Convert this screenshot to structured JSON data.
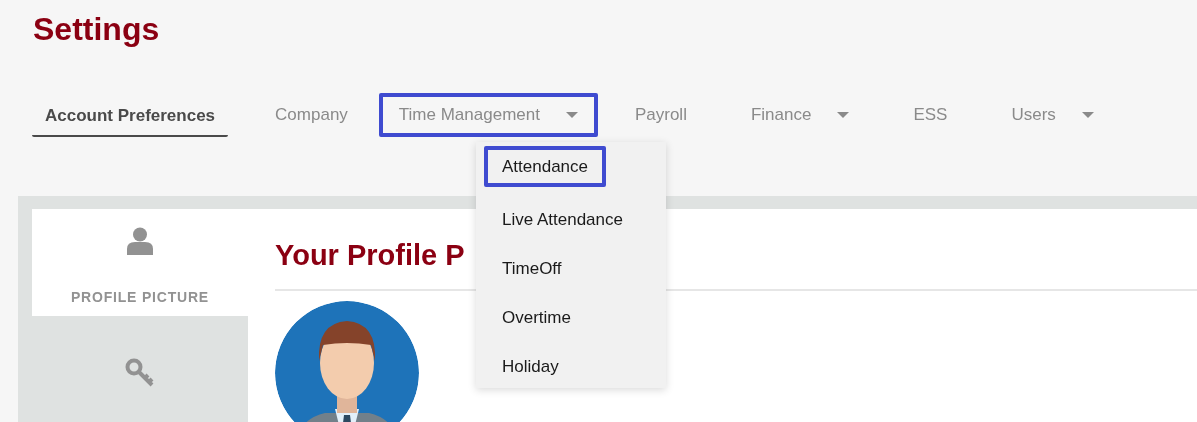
{
  "page_title": "Settings",
  "tabs": [
    {
      "label": "Account Preferences",
      "selected": true,
      "has_dropdown": false,
      "highlighted": false
    },
    {
      "label": "Company",
      "selected": false,
      "has_dropdown": false,
      "highlighted": false
    },
    {
      "label": "Time Management",
      "selected": false,
      "has_dropdown": true,
      "highlighted": true
    },
    {
      "label": "Payroll",
      "selected": false,
      "has_dropdown": false,
      "highlighted": false
    },
    {
      "label": "Finance",
      "selected": false,
      "has_dropdown": true,
      "highlighted": false
    },
    {
      "label": "ESS",
      "selected": false,
      "has_dropdown": false,
      "highlighted": false
    },
    {
      "label": "Users",
      "selected": false,
      "has_dropdown": true,
      "highlighted": false
    }
  ],
  "dropdown": {
    "items": [
      {
        "label": "Attendance",
        "highlighted": true
      },
      {
        "label": "Live Attendance",
        "highlighted": false
      },
      {
        "label": "TimeOff",
        "highlighted": false
      },
      {
        "label": "Overtime",
        "highlighted": false
      },
      {
        "label": "Holiday",
        "highlighted": false
      }
    ]
  },
  "sidebar": {
    "items": [
      {
        "label": "PROFILE PICTURE",
        "kind": "user",
        "selected": true
      },
      {
        "kind": "key",
        "selected": false
      }
    ]
  },
  "content": {
    "heading": "Your Profile P"
  }
}
